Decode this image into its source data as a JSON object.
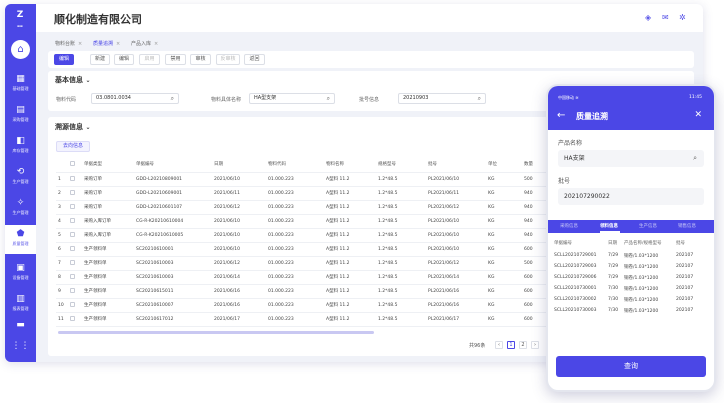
{
  "app": {
    "title": "顺化制造有限公司",
    "logo": "Z"
  },
  "sidebar": {
    "items": [
      {
        "icon": "▦",
        "label": "基础管理"
      },
      {
        "icon": "▤",
        "label": "采购管理"
      },
      {
        "icon": "◧",
        "label": "库存管理"
      },
      {
        "icon": "⟲",
        "label": "生产管理"
      },
      {
        "icon": "✧",
        "label": "生产管理"
      },
      {
        "icon": "⬟",
        "label": "质量管理"
      },
      {
        "icon": "▣",
        "label": "设备管理"
      },
      {
        "icon": "▥",
        "label": "报表管理"
      },
      {
        "icon": "▬",
        "label": ""
      },
      {
        "icon": "⋮⋮",
        "label": ""
      }
    ]
  },
  "tabs": [
    {
      "label": "物料台账"
    },
    {
      "label": "质量追溯"
    },
    {
      "label": "产品入库"
    }
  ],
  "toolbar": {
    "buttons": [
      "编辑",
      "新建",
      "编辑",
      "启用",
      "禁用",
      "审核",
      "反审核",
      "返回"
    ]
  },
  "basic": {
    "title": "基本信息",
    "material_code_label": "物料代码",
    "material_code_value": "03.0801.0034",
    "material_desc_label": "物料具体名称",
    "material_desc_value": "HA型支架",
    "batch_label": "批号信息",
    "batch_value": "20210903"
  },
  "trace": {
    "title": "溯源信息",
    "sub_button": "去向信息",
    "headers": [
      "",
      "",
      "单据类型",
      "单据编号",
      "日期",
      "物料代码",
      "物料名称",
      "规格型号",
      "批号",
      "单位",
      "数量"
    ],
    "rows": [
      [
        "1",
        "采购订单",
        "GDD-L20210809001",
        "2021/06/10",
        "01.000.223",
        "A型料 11.2",
        "1.2*48.5",
        "PL2021/06/10",
        "KG",
        "500"
      ],
      [
        "2",
        "采购订单",
        "GDD-L20210609001",
        "2021/06/11",
        "01.000.223",
        "A型料 11.2",
        "1.2*48.5",
        "PL2021/06/11",
        "KG",
        "940"
      ],
      [
        "3",
        "采购订单",
        "GDD-L20210601107",
        "2021/06/12",
        "01.000.223",
        "A型料 11.2",
        "1.2*48.5",
        "PL2021/06/12",
        "KG",
        "940"
      ],
      [
        "4",
        "采购入库订单",
        "CG-R-K20210610004",
        "2021/06/10",
        "01.000.223",
        "A型料 11.2",
        "1.2*48.5",
        "PL2021/06/10",
        "KG",
        "940"
      ],
      [
        "5",
        "采购入库订单",
        "CG-R-K20210610005",
        "2021/06/10",
        "01.000.223",
        "A型料 11.2",
        "1.2*48.5",
        "PL2021/06/10",
        "KG",
        "940"
      ],
      [
        "6",
        "生产领料单",
        "SC20210610001",
        "2021/06/10",
        "01.000.223",
        "A型料 11.2",
        "1.2*48.5",
        "PL2021/06/10",
        "KG",
        "600"
      ],
      [
        "7",
        "生产领料单",
        "SC20210610003",
        "2021/06/12",
        "01.000.223",
        "A型料 11.2",
        "1.2*48.5",
        "PL2021/06/12",
        "KG",
        "500"
      ],
      [
        "8",
        "生产领料单",
        "SC20210610003",
        "2021/06/14",
        "01.000.223",
        "A型料 11.2",
        "1.2*48.5",
        "PL2021/06/14",
        "KG",
        "600"
      ],
      [
        "9",
        "生产领料单",
        "SC20210615011",
        "2021/06/16",
        "01.000.223",
        "A型料 11.2",
        "1.2*48.5",
        "PL2021/06/16",
        "KG",
        "600"
      ],
      [
        "10",
        "生产领料单",
        "SC20210610007",
        "2021/06/16",
        "01.000.223",
        "A型料 11.2",
        "1.2*48.5",
        "PL2021/06/16",
        "KG",
        "600"
      ],
      [
        "11",
        "生产领料单",
        "SC20210617012",
        "2021/06/17",
        "01.000.223",
        "A型料 11.2",
        "1.2*48.5",
        "PL2021/06/17",
        "KG",
        "600"
      ],
      [
        "12",
        "生产领料单",
        "SC20210624013",
        "2021/06/24",
        "01.000.223",
        "A型料 11.2",
        "1.2*48.5",
        "PL2021/06/24",
        "KG",
        "600"
      ]
    ],
    "pager_total": "共96条",
    "pages": [
      "‹",
      "1",
      "2",
      "›"
    ]
  },
  "mobile": {
    "status": "中国移动 ≋",
    "time": "11:45",
    "title": "质量追溯",
    "product_label": "产品名称",
    "product_value": "HA支架",
    "batch_label": "批号",
    "batch_value": "202107290022",
    "tabs": [
      "采购信息",
      "领料信息",
      "生产信息",
      "销售信息"
    ],
    "headers": [
      "单据编号",
      "日期",
      "产品名称/规格型号",
      "批号"
    ],
    "rows": [
      [
        "SCLL20210729001",
        "7/29",
        "铜卷/1.03*1200",
        "202107"
      ],
      [
        "SCLL20210729003",
        "7/29",
        "铜卷/1.03*1200",
        "202107"
      ],
      [
        "SCLL20210729006",
        "7/29",
        "铜卷/1.03*1200",
        "202107"
      ],
      [
        "SCLL20210730001",
        "7/30",
        "铜卷/1.03*1200",
        "202107"
      ],
      [
        "SCLL20210730002",
        "7/30",
        "铜卷/1.03*1200",
        "202107"
      ],
      [
        "SCLL20210730003",
        "7/30",
        "铜卷/1.03*1200",
        "202107"
      ]
    ],
    "query_button": "查询"
  },
  "colors": {
    "accent": "#4b47e6",
    "bg": "#f0f2f8"
  }
}
